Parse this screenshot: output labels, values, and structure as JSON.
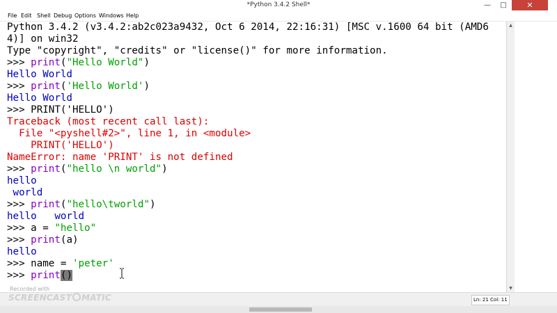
{
  "window": {
    "title": "*Python 3.4.2 Shell*",
    "minimize": "—",
    "maximize": "□",
    "close": "✕"
  },
  "menu": [
    "File",
    "Edit",
    "Shell",
    "Debug",
    "Options",
    "Windows",
    "Help"
  ],
  "shell": {
    "banner1": "Python 3.4.2 (v3.4.2:ab2c023a9432, Oct  6 2014, 22:16:31) [MSC v.1600 64 bit (AMD64)] on win32",
    "banner2": "Type \"copyright\", \"credits\" or \"license()\" for more information.",
    "prompt": ">>> ",
    "kw_print": "print",
    "open_paren": "(",
    "close_paren": ")",
    "s1": "\"Hello World\"",
    "out1": "Hello World",
    "s2": "'Hello World'",
    "out2": "Hello World",
    "cmd3": "PRINT('HELLO')",
    "tb1": "Traceback (most recent call last):",
    "tb2": "  File \"<pyshell#2>\", line 1, in <module>",
    "tb3": "    PRINT('HELLO')",
    "tb4": "NameError: name 'PRINT' is not defined",
    "s4": "\"hello \\n world\"",
    "out4a": "hello",
    "out4b": " world",
    "s5": "\"hello\\tworld\"",
    "out5": "hello   world",
    "assign6a": "a = ",
    "s6": "\"hello\"",
    "arg7": "a",
    "out7": "hello",
    "assign8a": "name = ",
    "s8": "'peter'",
    "cmd9_open": "(",
    "cmd9_close": ")"
  },
  "status": {
    "position": "Ln: 21  Col: 11"
  },
  "watermark": {
    "small": "Recorded with",
    "brand": "SCREENCAST",
    "brand2": "MATIC"
  },
  "colors": {
    "keyword": "#8a00c0",
    "string": "#00a000",
    "output": "#0000c0",
    "error": "#dd0000",
    "close_button": "#c7423a"
  },
  "icons": [
    "close-icon",
    "maximize-icon",
    "minimize-icon",
    "text-cursor-icon"
  ]
}
